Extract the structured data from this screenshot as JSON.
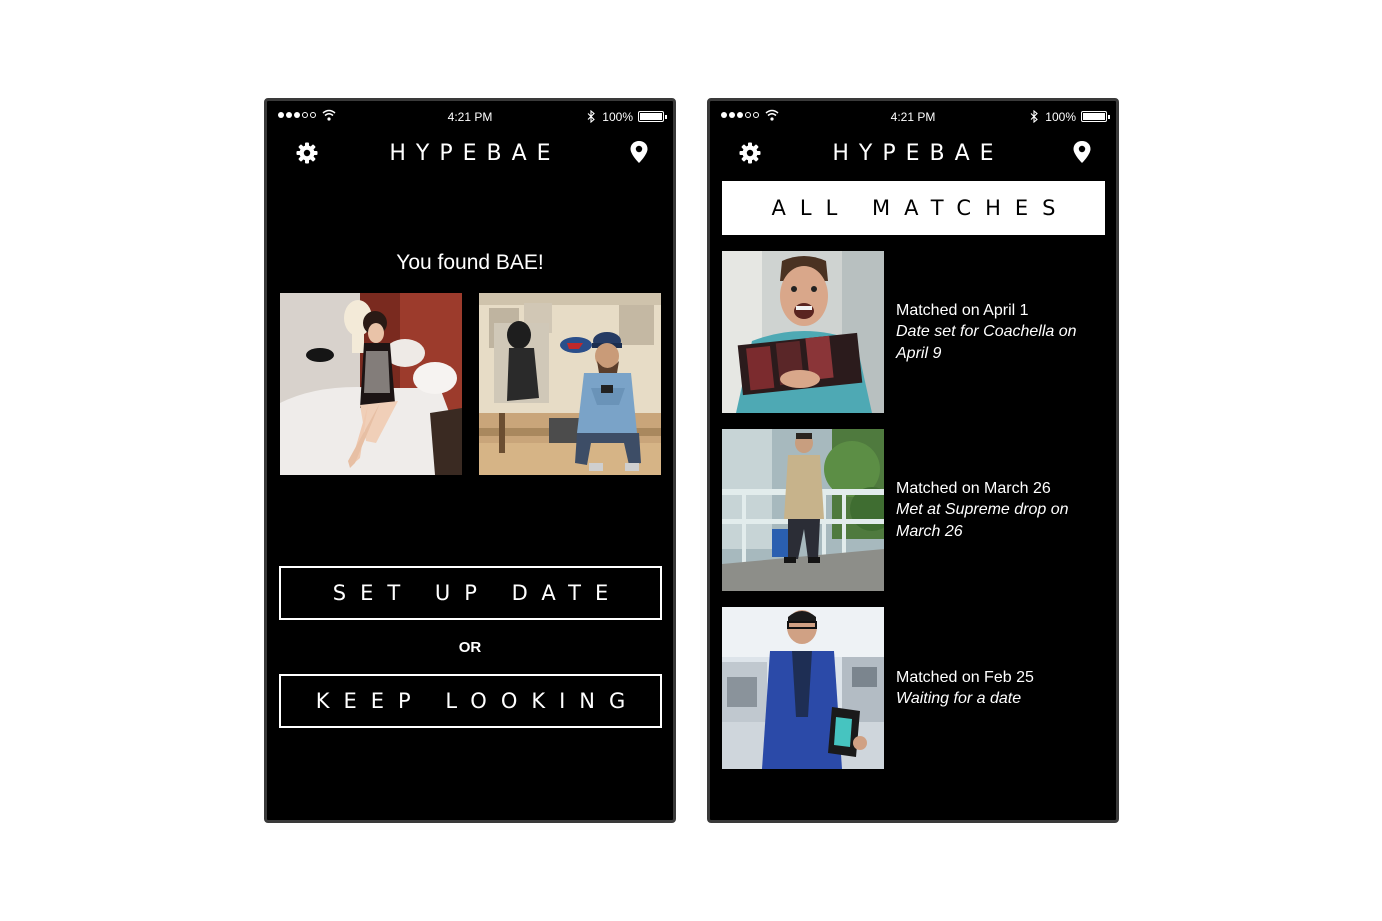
{
  "left_screen": {
    "status": {
      "time": "4:21 PM",
      "battery": "100%"
    },
    "brand": "HYPEBAE",
    "title": "You found BAE!",
    "setup_label": "SET UP DATE",
    "or_label": "OR",
    "keep_label": "KEEP LOOKING"
  },
  "right_screen": {
    "status": {
      "time": "4:21 PM",
      "battery": "100%"
    },
    "brand": "HYPEBAE",
    "header": "ALL MATCHES",
    "matches": [
      {
        "date": "Matched on April 1",
        "note": "Date set for Coachella on April 9"
      },
      {
        "date": "Matched on March 26",
        "note": "Met at Supreme drop on March 26"
      },
      {
        "date": "Matched on Feb 25",
        "note": "Waiting for a date"
      }
    ]
  }
}
